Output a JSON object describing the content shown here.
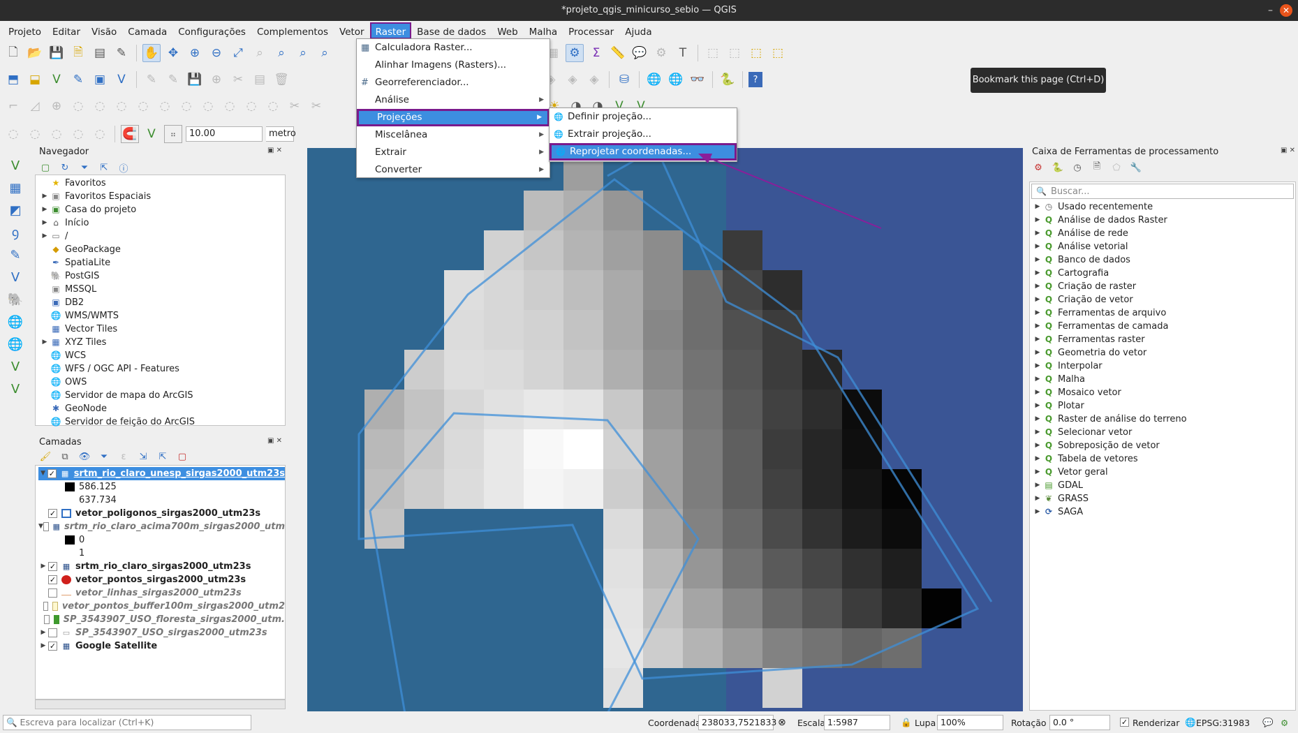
{
  "window": {
    "title": "*projeto_qgis_minicurso_sebio — QGIS",
    "minimize": "–",
    "maximize": "□",
    "close": "✕"
  },
  "menubar": [
    "Projeto",
    "Editar",
    "Visão",
    "Camada",
    "Configurações",
    "Complementos",
    "Vetor",
    "Raster",
    "Base de dados",
    "Web",
    "Malha",
    "Processar",
    "Ajuda"
  ],
  "toolbar": {
    "snap_value": "10.00",
    "snap_unit": "metro"
  },
  "tooltip": "Bookmark this page (Ctrl+D)",
  "raster_menu": {
    "items": [
      {
        "label": "Calculadora Raster...",
        "icon": "calculator-icon",
        "sub": false
      },
      {
        "label": "Alinhar Imagens (Rasters)...",
        "icon": "",
        "sub": false
      },
      {
        "label": "Georreferenciador...",
        "icon": "grid-icon",
        "sub": false
      },
      {
        "label": "Análise",
        "icon": "",
        "sub": true
      },
      {
        "label": "Projeções",
        "icon": "",
        "sub": true
      },
      {
        "label": "Miscelânea",
        "icon": "",
        "sub": true
      },
      {
        "label": "Extrair",
        "icon": "",
        "sub": true
      },
      {
        "label": "Converter",
        "icon": "",
        "sub": true
      }
    ]
  },
  "projections_submenu": [
    "Definir projeção...",
    "Extrair projeção...",
    "Reprojetar coordenadas..."
  ],
  "navigator": {
    "title": "Navegador",
    "items": [
      {
        "label": "Favoritos",
        "icon": "star-icon",
        "expand": false
      },
      {
        "label": "Favoritos Espaciais",
        "icon": "spatial-bookmark-icon",
        "expand": true
      },
      {
        "label": "Casa do projeto",
        "icon": "project-home-icon",
        "expand": true
      },
      {
        "label": "Início",
        "icon": "home-folder-icon",
        "expand": true
      },
      {
        "label": "/",
        "icon": "folder-icon",
        "expand": true
      },
      {
        "label": "GeoPackage",
        "icon": "geopackage-icon",
        "expand": false
      },
      {
        "label": "SpatiaLite",
        "icon": "spatialite-icon",
        "expand": false
      },
      {
        "label": "PostGIS",
        "icon": "postgis-icon",
        "expand": false
      },
      {
        "label": "MSSQL",
        "icon": "mssql-icon",
        "expand": false
      },
      {
        "label": "DB2",
        "icon": "db2-icon",
        "expand": false
      },
      {
        "label": "WMS/WMTS",
        "icon": "globe-icon",
        "expand": false
      },
      {
        "label": "Vector Tiles",
        "icon": "tiles-icon",
        "expand": false
      },
      {
        "label": "XYZ Tiles",
        "icon": "tiles-icon",
        "expand": true
      },
      {
        "label": "WCS",
        "icon": "globe-icon",
        "expand": false
      },
      {
        "label": "WFS / OGC API - Features",
        "icon": "globe-icon",
        "expand": false
      },
      {
        "label": "OWS",
        "icon": "globe-icon",
        "expand": false
      },
      {
        "label": "Servidor de mapa do ArcGIS",
        "icon": "globe-icon",
        "expand": false
      },
      {
        "label": "GeoNode",
        "icon": "geonode-icon",
        "expand": false
      },
      {
        "label": "Servidor de feição do ArcGIS",
        "icon": "globe-icon",
        "expand": false
      }
    ]
  },
  "layers": {
    "title": "Camadas",
    "items": [
      {
        "label": "srtm_rio_claro_unesp_sirgas2000_utm23s",
        "checked": true,
        "style": "bold-selected",
        "expand": "open",
        "indent": 0
      },
      {
        "label": "586.125",
        "checked": null,
        "style": "legend",
        "swatch": "#000000",
        "indent": 1
      },
      {
        "label": "637.734",
        "checked": null,
        "style": "legend",
        "swatch": "",
        "indent": 1
      },
      {
        "label": "vetor_poligonos_sirgas2000_utm23s",
        "checked": true,
        "style": "bold",
        "swatch": "poly",
        "indent": 0
      },
      {
        "label": "srtm_rio_claro_acima700m_sirgas2000_utm",
        "checked": false,
        "style": "italic",
        "expand": "open",
        "indent": 0
      },
      {
        "label": "0",
        "checked": null,
        "style": "legend",
        "swatch": "#000000",
        "indent": 1
      },
      {
        "label": "1",
        "checked": null,
        "style": "legend",
        "swatch": "",
        "indent": 1
      },
      {
        "label": "srtm_rio_claro_sirgas2000_utm23s",
        "checked": true,
        "style": "bold",
        "expand": "closed",
        "indent": 0
      },
      {
        "label": "vetor_pontos_sirgas2000_utm23s",
        "checked": true,
        "style": "bold",
        "swatch": "point",
        "indent": 0
      },
      {
        "label": "vetor_linhas_sirgas2000_utm23s",
        "checked": false,
        "style": "italic",
        "swatch": "line",
        "indent": 0
      },
      {
        "label": "vetor_pontos_buffer100m_sirgas2000_utm2",
        "checked": false,
        "style": "italic",
        "swatch": "buffer",
        "indent": 0
      },
      {
        "label": "SP_3543907_USO_floresta_sirgas2000_utm.",
        "checked": false,
        "style": "italic",
        "swatch": "forest",
        "indent": 0
      },
      {
        "label": "SP_3543907_USO_sirgas2000_utm23s",
        "checked": false,
        "style": "italic",
        "expand": "closed",
        "indent": 0
      },
      {
        "label": "Google Satellite",
        "checked": true,
        "style": "bold",
        "expand": "closed",
        "indent": 0
      }
    ]
  },
  "processing": {
    "title": "Caixa de Ferramentas de processamento",
    "search_placeholder": "Buscar...",
    "items": [
      "Usado recentemente",
      "Análise de dados Raster",
      "Análise de rede",
      "Análise vetorial",
      "Banco de dados",
      "Cartografia",
      "Criação de raster",
      "Criação de vetor",
      "Ferramentas de arquivo",
      "Ferramentas de camada",
      "Ferramentas raster",
      "Geometria do vetor",
      "Interpolar",
      "Malha",
      "Mosaico vetor",
      "Plotar",
      "Raster de análise do terreno",
      "Selecionar vetor",
      "Sobreposição de vetor",
      "Tabela de vetores",
      "Vetor geral",
      "GDAL",
      "GRASS",
      "SAGA"
    ]
  },
  "statusbar": {
    "locator_placeholder": "Escreva para localizar (Ctrl+K)",
    "coord_label": "Coordenada",
    "coord_value": "238033,7521833",
    "scale_label": "Escala",
    "scale_value": "1:5987",
    "magnifier_label": "Lupa",
    "magnifier_value": "100%",
    "rotation_label": "Rotação",
    "rotation_value": "0.0 °",
    "render_label": "Renderizar",
    "crs": "EPSG:31983"
  },
  "raster_grid": [
    [
      0,
      0,
      0,
      0,
      0,
      0,
      0,
      0,
      0,
      0,
      0,
      0,
      0,
      0,
      0,
      0
    ],
    [
      0,
      0,
      0,
      0,
      0,
      158,
      0,
      0,
      0,
      0,
      0,
      0,
      0,
      0,
      0,
      0
    ],
    [
      0,
      0,
      0,
      0,
      188,
      175,
      150,
      0,
      0,
      0,
      0,
      0,
      0,
      0,
      0,
      0
    ],
    [
      0,
      0,
      0,
      210,
      198,
      180,
      160,
      140,
      0,
      58,
      0,
      0,
      0,
      0,
      0,
      0
    ],
    [
      0,
      0,
      222,
      215,
      205,
      190,
      170,
      140,
      110,
      70,
      45,
      0,
      0,
      0,
      0,
      0
    ],
    [
      0,
      0,
      220,
      215,
      210,
      195,
      170,
      135,
      110,
      80,
      60,
      0,
      0,
      0,
      0,
      0
    ],
    [
      0,
      205,
      222,
      220,
      212,
      200,
      175,
      140,
      115,
      85,
      60,
      38,
      0,
      0,
      0,
      0
    ],
    [
      175,
      195,
      215,
      225,
      232,
      228,
      200,
      150,
      120,
      90,
      65,
      45,
      12,
      0,
      0,
      0
    ],
    [
      185,
      200,
      218,
      232,
      248,
      255,
      210,
      160,
      125,
      95,
      60,
      38,
      15,
      0,
      0,
      0
    ],
    [
      190,
      205,
      220,
      232,
      245,
      240,
      205,
      160,
      125,
      95,
      65,
      38,
      20,
      5,
      0,
      0
    ],
    [
      195,
      0,
      0,
      0,
      0,
      0,
      220,
      170,
      130,
      105,
      75,
      50,
      28,
      12,
      0,
      0
    ],
    [
      0,
      0,
      0,
      0,
      0,
      0,
      225,
      185,
      150,
      115,
      90,
      70,
      48,
      30,
      0,
      0
    ],
    [
      0,
      0,
      0,
      0,
      0,
      0,
      228,
      195,
      165,
      135,
      105,
      85,
      60,
      40,
      2,
      0
    ],
    [
      0,
      0,
      0,
      0,
      0,
      0,
      230,
      205,
      180,
      155,
      130,
      115,
      100,
      110,
      0,
      0
    ],
    [
      0,
      0,
      0,
      0,
      0,
      0,
      225,
      0,
      0,
      0,
      210,
      0,
      0,
      0,
      0,
      0
    ]
  ]
}
